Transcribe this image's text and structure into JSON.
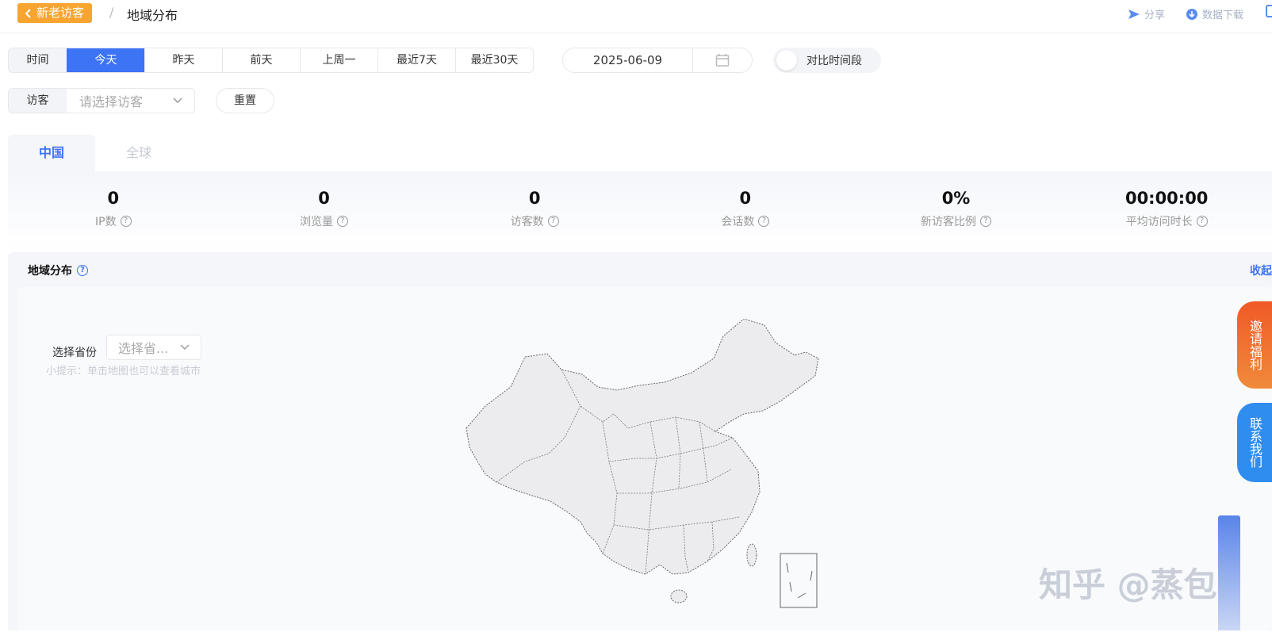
{
  "topbar": {
    "back_label": "新老访客",
    "separator": "/",
    "current": "地域分布",
    "share": "分享",
    "download": "数据下载"
  },
  "time": {
    "label": "时间",
    "options": [
      "今天",
      "昨天",
      "前天",
      "上周一",
      "最近7天",
      "最近30天"
    ],
    "active": "今天",
    "date": "2025-06-09",
    "compare_label": "对比时间段"
  },
  "visitor": {
    "label": "访客",
    "placeholder": "请选择访客",
    "reset": "重置"
  },
  "tabs": [
    "中国",
    "全球"
  ],
  "stats": [
    {
      "value": "0",
      "label": "IP数"
    },
    {
      "value": "0",
      "label": "浏览量"
    },
    {
      "value": "0",
      "label": "访客数"
    },
    {
      "value": "0",
      "label": "会话数"
    },
    {
      "value": "0%",
      "label": "新访客比例"
    },
    {
      "value": "00:00:00",
      "label": "平均访问时长"
    }
  ],
  "region": {
    "title": "地域分布",
    "collapse": "收起",
    "province_label": "选择省份",
    "province_placeholder": "选择省...",
    "hint": "小提示：单击地图也可以查看城市"
  },
  "floating": {
    "invite": "邀请福利",
    "contact": "联系我们"
  },
  "watermark": "知乎 @蒸包",
  "colors": {
    "accent": "#3d74f5",
    "back_button": "#f7a530",
    "invite": "#f05a28",
    "contact": "#2f8df0"
  }
}
